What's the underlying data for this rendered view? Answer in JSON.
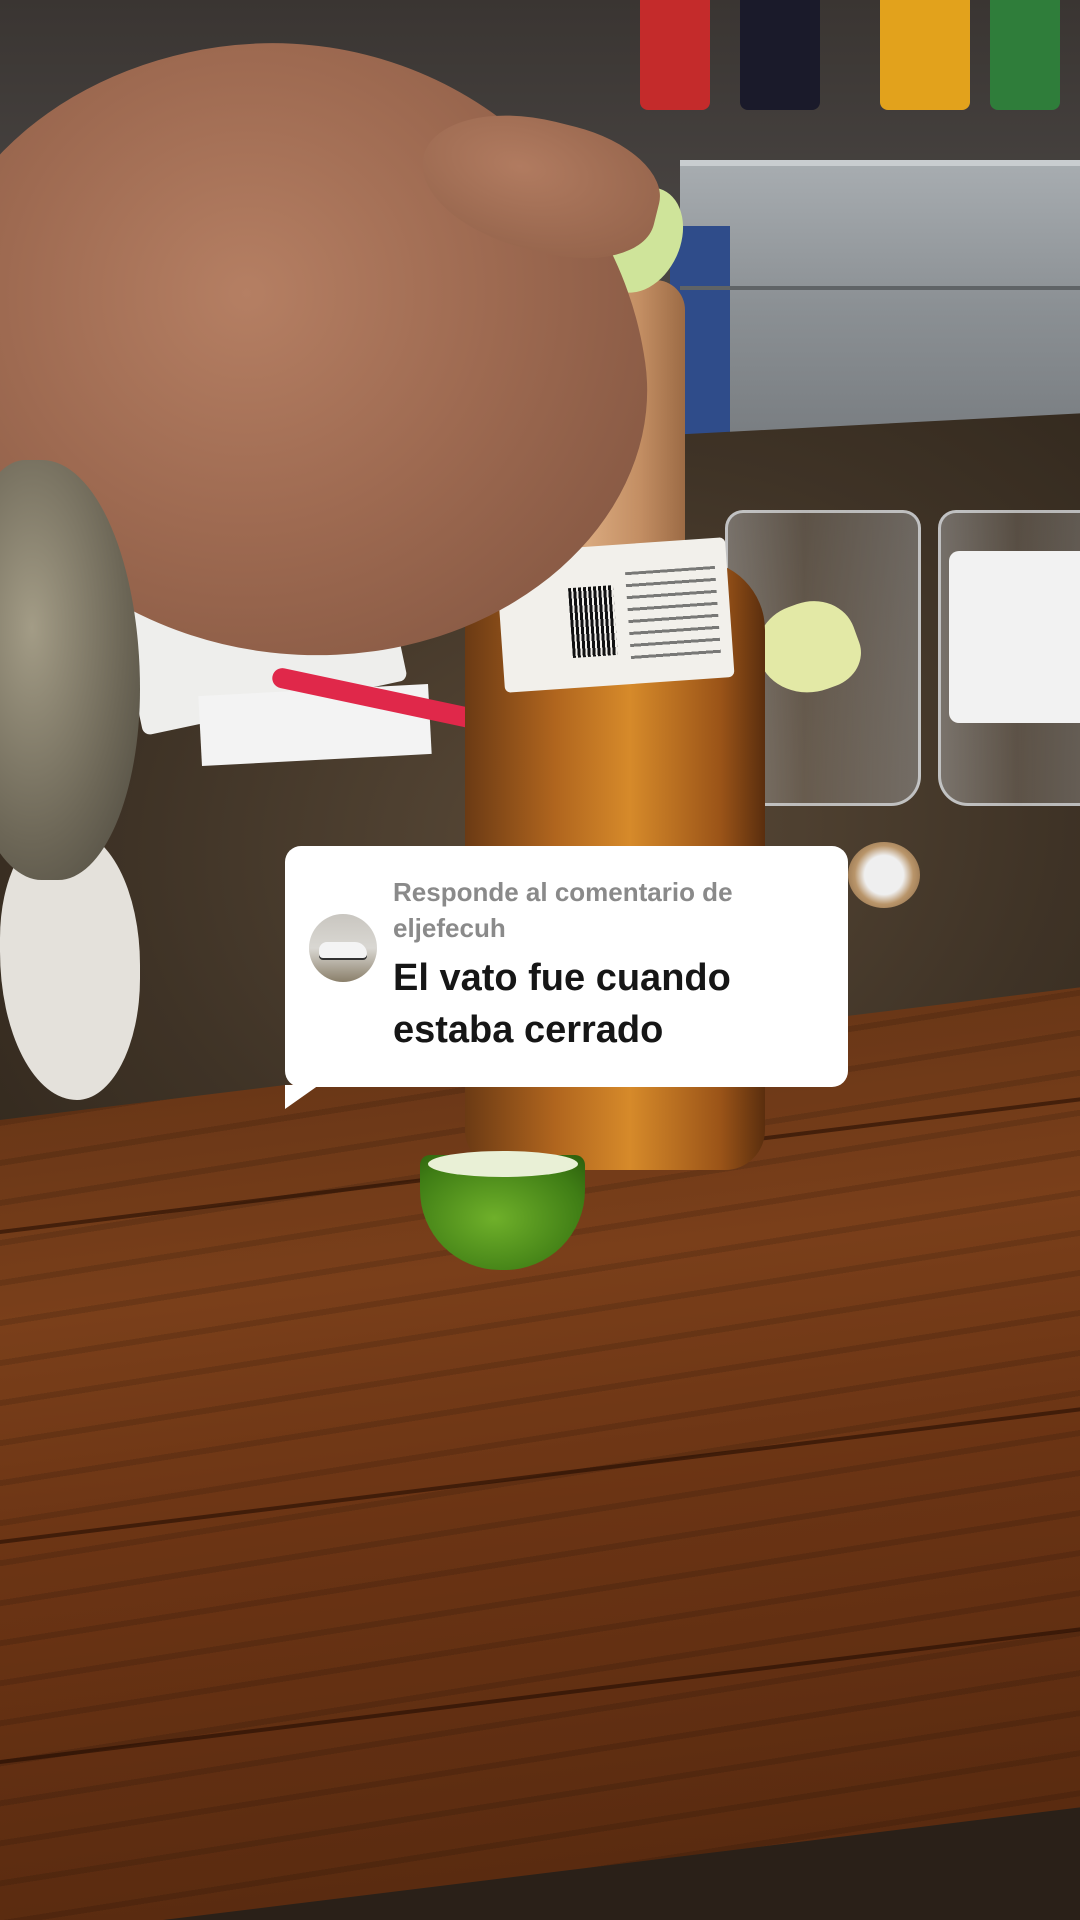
{
  "reply_sticker": {
    "caption": "Responde al comentario de eljefecuh",
    "comment_text": "El vato fue cuando estaba cerrado",
    "avatar_icon": "car-photo-avatar"
  },
  "colors": {
    "sticker_background": "#ffffff",
    "caption_text": "#8a8a8a",
    "comment_text": "#161616"
  }
}
